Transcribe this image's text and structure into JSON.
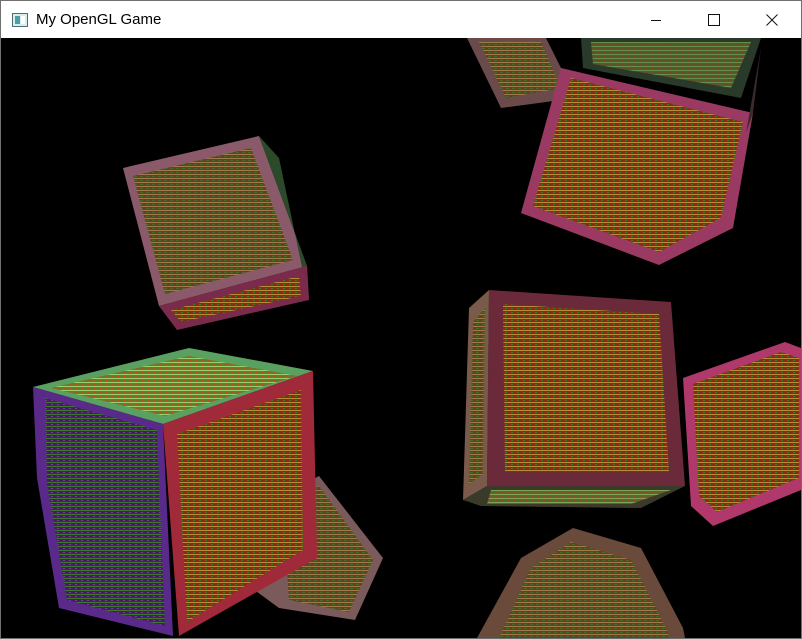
{
  "window": {
    "title": "My OpenGL Game",
    "controls": {
      "minimize_icon": "minimize-icon",
      "maximize_icon": "maximize-icon",
      "close_icon": "close-icon"
    }
  },
  "scene": {
    "background": "#000000",
    "object_kind": "textured rotating crates",
    "crate_count": 8
  }
}
